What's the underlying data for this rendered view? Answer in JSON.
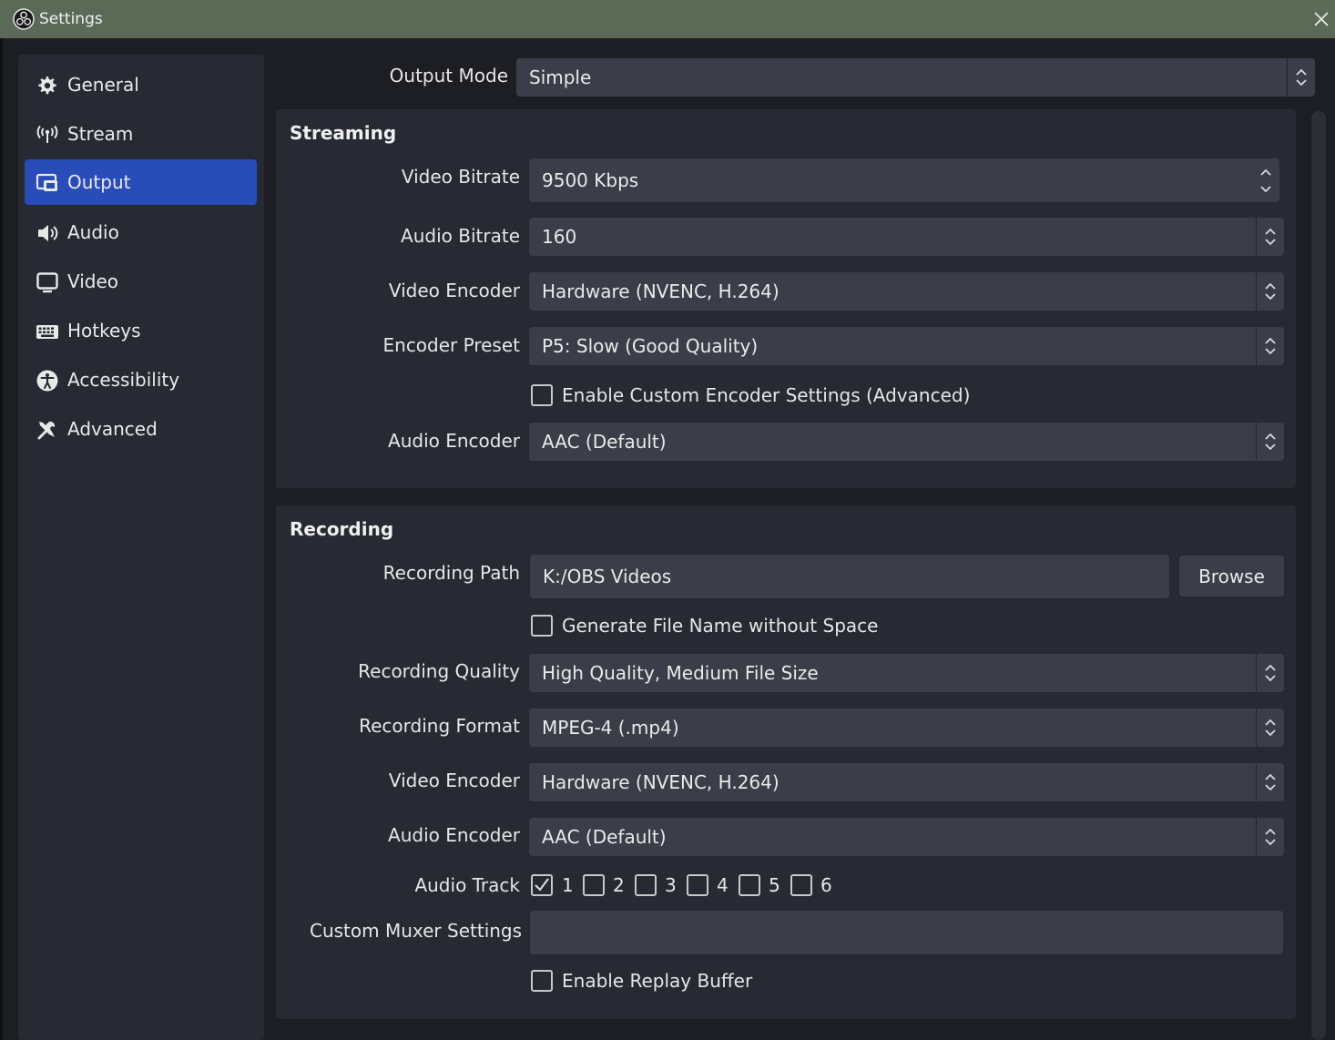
{
  "window": {
    "title": "Settings"
  },
  "sidebar": {
    "items": [
      {
        "label": "General",
        "icon": "gear-icon"
      },
      {
        "label": "Stream",
        "icon": "broadcast-icon"
      },
      {
        "label": "Output",
        "icon": "output-icon",
        "active": true
      },
      {
        "label": "Audio",
        "icon": "speaker-icon"
      },
      {
        "label": "Video",
        "icon": "monitor-icon"
      },
      {
        "label": "Hotkeys",
        "icon": "keyboard-icon"
      },
      {
        "label": "Accessibility",
        "icon": "accessibility-icon"
      },
      {
        "label": "Advanced",
        "icon": "tools-icon"
      }
    ]
  },
  "output_mode": {
    "label": "Output Mode",
    "value": "Simple"
  },
  "streaming": {
    "title": "Streaming",
    "video_bitrate": {
      "label": "Video Bitrate",
      "value": "9500 Kbps"
    },
    "audio_bitrate": {
      "label": "Audio Bitrate",
      "value": "160"
    },
    "video_encoder": {
      "label": "Video Encoder",
      "value": "Hardware (NVENC, H.264)"
    },
    "encoder_preset": {
      "label": "Encoder Preset",
      "value": "P5: Slow (Good Quality)"
    },
    "custom_encoder": {
      "label": "Enable Custom Encoder Settings (Advanced)",
      "checked": false
    },
    "audio_encoder": {
      "label": "Audio Encoder",
      "value": "AAC (Default)"
    }
  },
  "recording": {
    "title": "Recording",
    "path": {
      "label": "Recording Path",
      "value": "K:/OBS Videos"
    },
    "browse_label": "Browse",
    "no_space": {
      "label": "Generate File Name without Space",
      "checked": false
    },
    "quality": {
      "label": "Recording Quality",
      "value": "High Quality, Medium File Size"
    },
    "format": {
      "label": "Recording Format",
      "value": "MPEG-4 (.mp4)"
    },
    "video_encoder": {
      "label": "Video Encoder",
      "value": "Hardware (NVENC, H.264)"
    },
    "audio_encoder": {
      "label": "Audio Encoder",
      "value": "AAC (Default)"
    },
    "audio_track": {
      "label": "Audio Track",
      "tracks": [
        {
          "label": "1",
          "checked": true
        },
        {
          "label": "2",
          "checked": false
        },
        {
          "label": "3",
          "checked": false
        },
        {
          "label": "4",
          "checked": false
        },
        {
          "label": "5",
          "checked": false
        },
        {
          "label": "6",
          "checked": false
        }
      ]
    },
    "muxer": {
      "label": "Custom Muxer Settings",
      "value": ""
    },
    "replay_buffer": {
      "label": "Enable Replay Buffer",
      "checked": false
    }
  }
}
